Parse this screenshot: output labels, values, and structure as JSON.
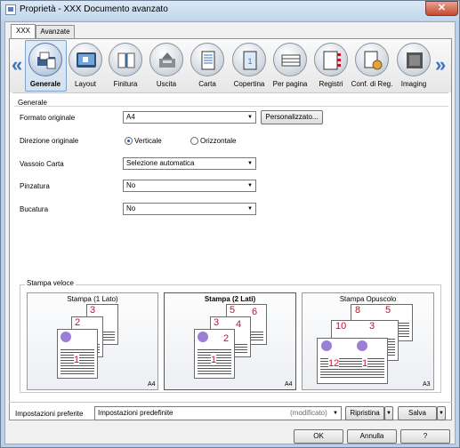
{
  "window": {
    "title": "Proprietà - XXX Documento avanzato",
    "close": "✕"
  },
  "tabs": [
    {
      "label": "XXX"
    },
    {
      "label": "Avanzate"
    }
  ],
  "nav": {
    "prev": "«",
    "next": "»"
  },
  "icons": [
    {
      "label": "Generale",
      "icon": "general-icon"
    },
    {
      "label": "Layout",
      "icon": "layout-icon"
    },
    {
      "label": "Finitura",
      "icon": "finishing-icon"
    },
    {
      "label": "Uscita",
      "icon": "output-icon"
    },
    {
      "label": "Carta",
      "icon": "paper-icon"
    },
    {
      "label": "Copertina",
      "icon": "cover-icon"
    },
    {
      "label": "Per pagina",
      "icon": "per-page-icon"
    },
    {
      "label": "Registri",
      "icon": "tabs-icon"
    },
    {
      "label": "Conf. di Reg.",
      "icon": "registry-config-icon"
    },
    {
      "label": "Imaging",
      "icon": "imaging-icon"
    }
  ],
  "general": {
    "group_label": "Generale",
    "formato_label": "Formato originale",
    "formato_value": "A4",
    "personalizzato": "Personalizzato...",
    "direzione_label": "Direzione originale",
    "verticale": "Verticale",
    "orizzontale": "Orizzontale",
    "vassoio_label": "Vassoio Carta",
    "vassoio_value": "Selezione automatica",
    "pinzatura_label": "Pinzatura",
    "pinzatura_value": "No",
    "bucatura_label": "Bucatura",
    "bucatura_value": "No"
  },
  "quick": {
    "label": "Stampa veloce",
    "cards": [
      {
        "title": "Stampa (1 Lato)",
        "size": "A4",
        "bold": false
      },
      {
        "title": "Stampa (2 Lati)",
        "size": "A4",
        "bold": true
      },
      {
        "title": "Stampa Opuscolo",
        "size": "A3",
        "bold": false
      }
    ],
    "page_numbers": {
      "one_side": [
        "3",
        "2",
        "1"
      ],
      "two_side": [
        "5",
        "6",
        "3",
        "4",
        "1",
        "2"
      ],
      "booklet": [
        "8",
        "5",
        "10",
        "3",
        "12",
        "1"
      ]
    }
  },
  "bottom": {
    "pref_label": "Impostazioni preferite",
    "pref_value": "Impostazioni predefinite",
    "modified": "(modificato)",
    "ripristina": "Ripristina",
    "salva": "Salva",
    "ok": "OK",
    "annulla": "Annulla",
    "help": "?"
  },
  "colors": {
    "accent": "#3a72c0",
    "page_number": "#c8102e"
  }
}
